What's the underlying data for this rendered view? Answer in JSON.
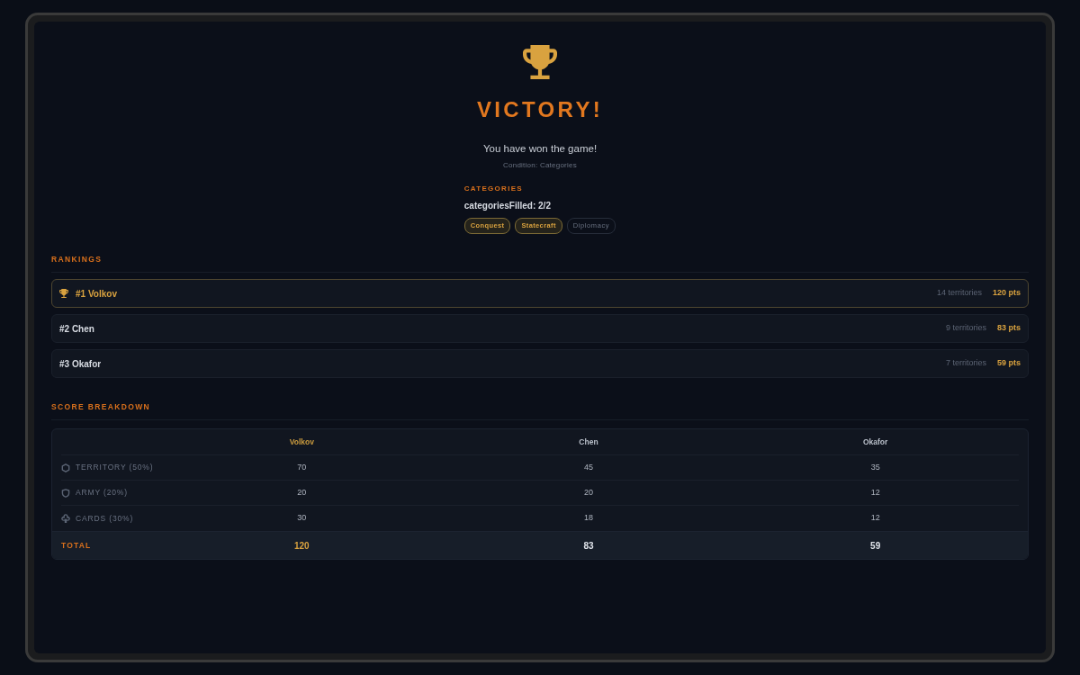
{
  "header": {
    "title": "VICTORY!",
    "message": "You have won the game!",
    "condition": "Condition: Categories"
  },
  "categories": {
    "label": "CATEGORIES",
    "progress": "categoriesFilled: 2/2",
    "tags": [
      {
        "label": "Conquest",
        "filled": true
      },
      {
        "label": "Statecraft",
        "filled": true
      },
      {
        "label": "Diplomacy",
        "filled": false
      }
    ]
  },
  "rankings": {
    "title": "RANKINGS",
    "rows": [
      {
        "name": "#1 Volkov",
        "territories": "14 territories",
        "points": "120 pts",
        "winner": true
      },
      {
        "name": "#2 Chen",
        "territories": "9 territories",
        "points": "83 pts",
        "winner": false
      },
      {
        "name": "#3 Okafor",
        "territories": "7 territories",
        "points": "59 pts",
        "winner": false
      }
    ]
  },
  "score_breakdown": {
    "title": "SCORE BREAKDOWN",
    "columns": [
      {
        "label": "Volkov",
        "winner": true
      },
      {
        "label": "Chen",
        "winner": false
      },
      {
        "label": "Okafor",
        "winner": false
      }
    ],
    "rows": [
      {
        "kind": "territory",
        "label": "TERRITORY (50%)",
        "values": [
          "70",
          "45",
          "35"
        ]
      },
      {
        "kind": "army",
        "label": "ARMY (20%)",
        "values": [
          "20",
          "20",
          "12"
        ]
      },
      {
        "kind": "cards",
        "label": "CARDS (30%)",
        "values": [
          "30",
          "18",
          "12"
        ]
      }
    ],
    "total": {
      "label": "TOTAL",
      "values": [
        "120",
        "83",
        "59"
      ]
    }
  }
}
